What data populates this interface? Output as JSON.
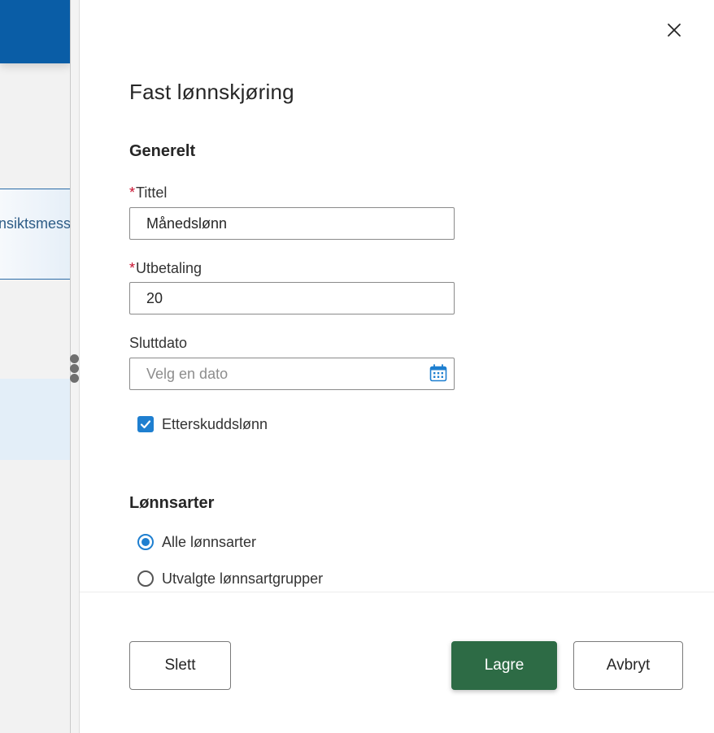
{
  "background": {
    "banner_text": "nsiktsmess",
    "header_color": "#0a5da6"
  },
  "panel": {
    "title": "Fast lønnskjøring",
    "close_icon": "close-icon"
  },
  "general": {
    "heading": "Generelt",
    "required_marker": "*",
    "title_field": {
      "label": "Tittel",
      "value": "Månedslønn"
    },
    "payout_field": {
      "label": "Utbetaling",
      "value": "20"
    },
    "end_date_field": {
      "label": "Sluttdato",
      "placeholder": "Velg en dato",
      "icon": "calendar-icon"
    },
    "arrears_checkbox": {
      "label": "Etterskuddslønn",
      "checked": true
    }
  },
  "wage_types": {
    "heading": "Lønnsarter",
    "options": [
      {
        "label": "Alle lønnsarter",
        "selected": true
      },
      {
        "label": "Utvalgte lønnsartgrupper",
        "selected": false
      }
    ]
  },
  "footer": {
    "delete_label": "Slett",
    "save_label": "Lagre",
    "cancel_label": "Avbryt"
  },
  "colors": {
    "accent": "#1e7fd0",
    "primary_button": "#2d6b45",
    "required": "#c8102e"
  }
}
